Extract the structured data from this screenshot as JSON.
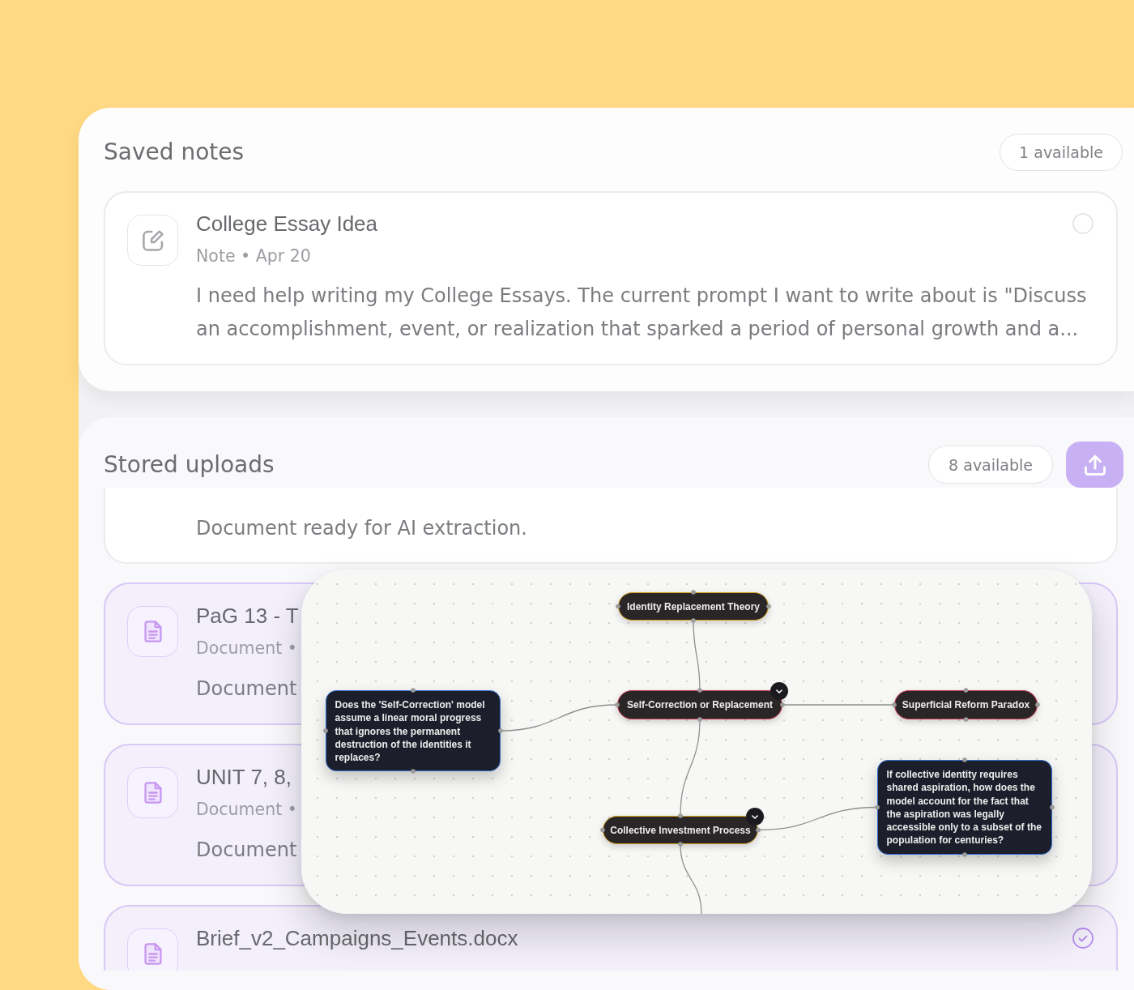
{
  "saved_notes": {
    "title": "Saved notes",
    "count": "1 available",
    "items": [
      {
        "title": "College Essay Idea",
        "meta": "Note • Apr 20",
        "description": "I need help writing my College Essays. The current prompt I want to write about is \"Discuss an accomplishment, event, or realization that sparked a period of personal growth and a...",
        "selected": false
      }
    ]
  },
  "stored_uploads": {
    "title": "Stored uploads",
    "count": "8 available",
    "items": [
      {
        "description": "Document ready for AI extraction.",
        "selected": false
      },
      {
        "title": "PaG 13 - T",
        "meta": "Document •",
        "description": "Document",
        "selected": true,
        "covered_by_map": true
      },
      {
        "title": "UNIT 7, 8,",
        "meta": "Document •",
        "description": "Document",
        "selected": true,
        "covered_by_map": true
      },
      {
        "title": "Brief_v2_Campaigns_Events.docx",
        "selected": true,
        "covered_by_map": false
      }
    ]
  },
  "mind_map": {
    "nodes": [
      {
        "kind": "topic",
        "label": "Identity Replacement Theory",
        "color": "#d6a324",
        "collapse_toggle": false,
        "offscreen_link": false,
        "children": [
          {
            "kind": "topic",
            "label": "Self-Correction or Replacement",
            "color": "#c9304b",
            "collapse_toggle": true,
            "offscreen_link": false,
            "children": [
              {
                "kind": "question",
                "label": "Does the 'Self-Correction' model assume a linear moral progress that ignores the permanent destruction of the identities it replaces?",
                "color": "#2f6fd0",
                "collapse_toggle": false,
                "offscreen_link": false
              },
              {
                "kind": "topic",
                "label": "Superficial Reform Paradox",
                "color": "#c9304b",
                "collapse_toggle": false,
                "offscreen_link": false
              },
              {
                "kind": "topic",
                "label": "Collective Investment Process",
                "color": "#d6a324",
                "collapse_toggle": true,
                "offscreen_link": true,
                "children": [
                  {
                    "kind": "question",
                    "label": "If collective identity requires shared aspiration, how does the model account for the fact that the aspiration was legally accessible only to a subset of the population for centuries?",
                    "color": "#2f6fd0",
                    "collapse_toggle": false,
                    "offscreen_link": false
                  }
                ]
              }
            ]
          }
        ]
      }
    ]
  }
}
